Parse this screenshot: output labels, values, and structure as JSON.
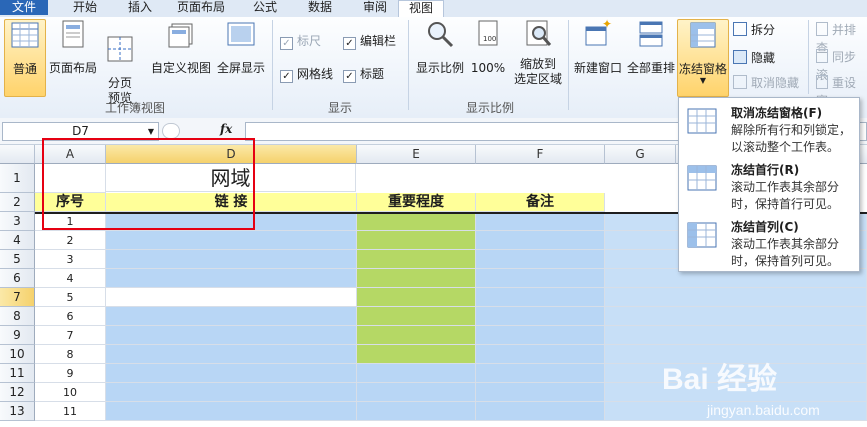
{
  "tabs": [
    "文件",
    "开始",
    "插入",
    "页面布局",
    "公式",
    "数据",
    "审阅",
    "视图"
  ],
  "ribbon": {
    "views": [
      "普通",
      "页面布局",
      "分页\n预览",
      "自定义视图",
      "全屏显示"
    ],
    "views_group": "工作簿视图",
    "show": {
      "ruler": "标尺",
      "formula_bar": "编辑栏",
      "gridlines": "网格线",
      "headings": "标题"
    },
    "show_group": "显示",
    "zoom": {
      "zoom": "显示比例",
      "hundred": "100%",
      "zoom_sel_1": "缩放到",
      "zoom_sel_2": "选定区域"
    },
    "zoom_group": "显示比例",
    "window": {
      "new_window": "新建窗口",
      "arrange": "全部重排",
      "freeze": "冻结窗格",
      "split": "拆分",
      "hide": "隐藏",
      "unhide": "取消隐藏",
      "side_by_side": "并排查",
      "sync": "同步滚",
      "reset": "重设窗"
    }
  },
  "formula_bar": {
    "name_box": "D7",
    "fx": "fx"
  },
  "grid": {
    "columns": [
      "A",
      "D",
      "E",
      "F",
      "G"
    ],
    "rows": [
      "1",
      "2",
      "3",
      "4",
      "5",
      "6",
      "7",
      "8",
      "9",
      "10",
      "11",
      "12",
      "13"
    ],
    "title": "网域",
    "headers": [
      "序号",
      "链 接",
      "重要程度",
      "备注"
    ],
    "seq": [
      "1",
      "2",
      "3",
      "4",
      "5",
      "6",
      "7",
      "8",
      "9",
      "10",
      "11"
    ]
  },
  "menu": [
    {
      "title": "取消冻结窗格(F)",
      "desc": "解除所有行和列锁定，以滚动整个工作表。"
    },
    {
      "title": "冻结首行(R)",
      "desc": "滚动工作表其余部分时，保持首行可见。"
    },
    {
      "title": "冻结首列(C)",
      "desc": "滚动工作表其余部分时，保持首列可见。"
    }
  ],
  "watermark": {
    "brand": "Bai 经验",
    "url": "jingyan.baidu.com"
  }
}
